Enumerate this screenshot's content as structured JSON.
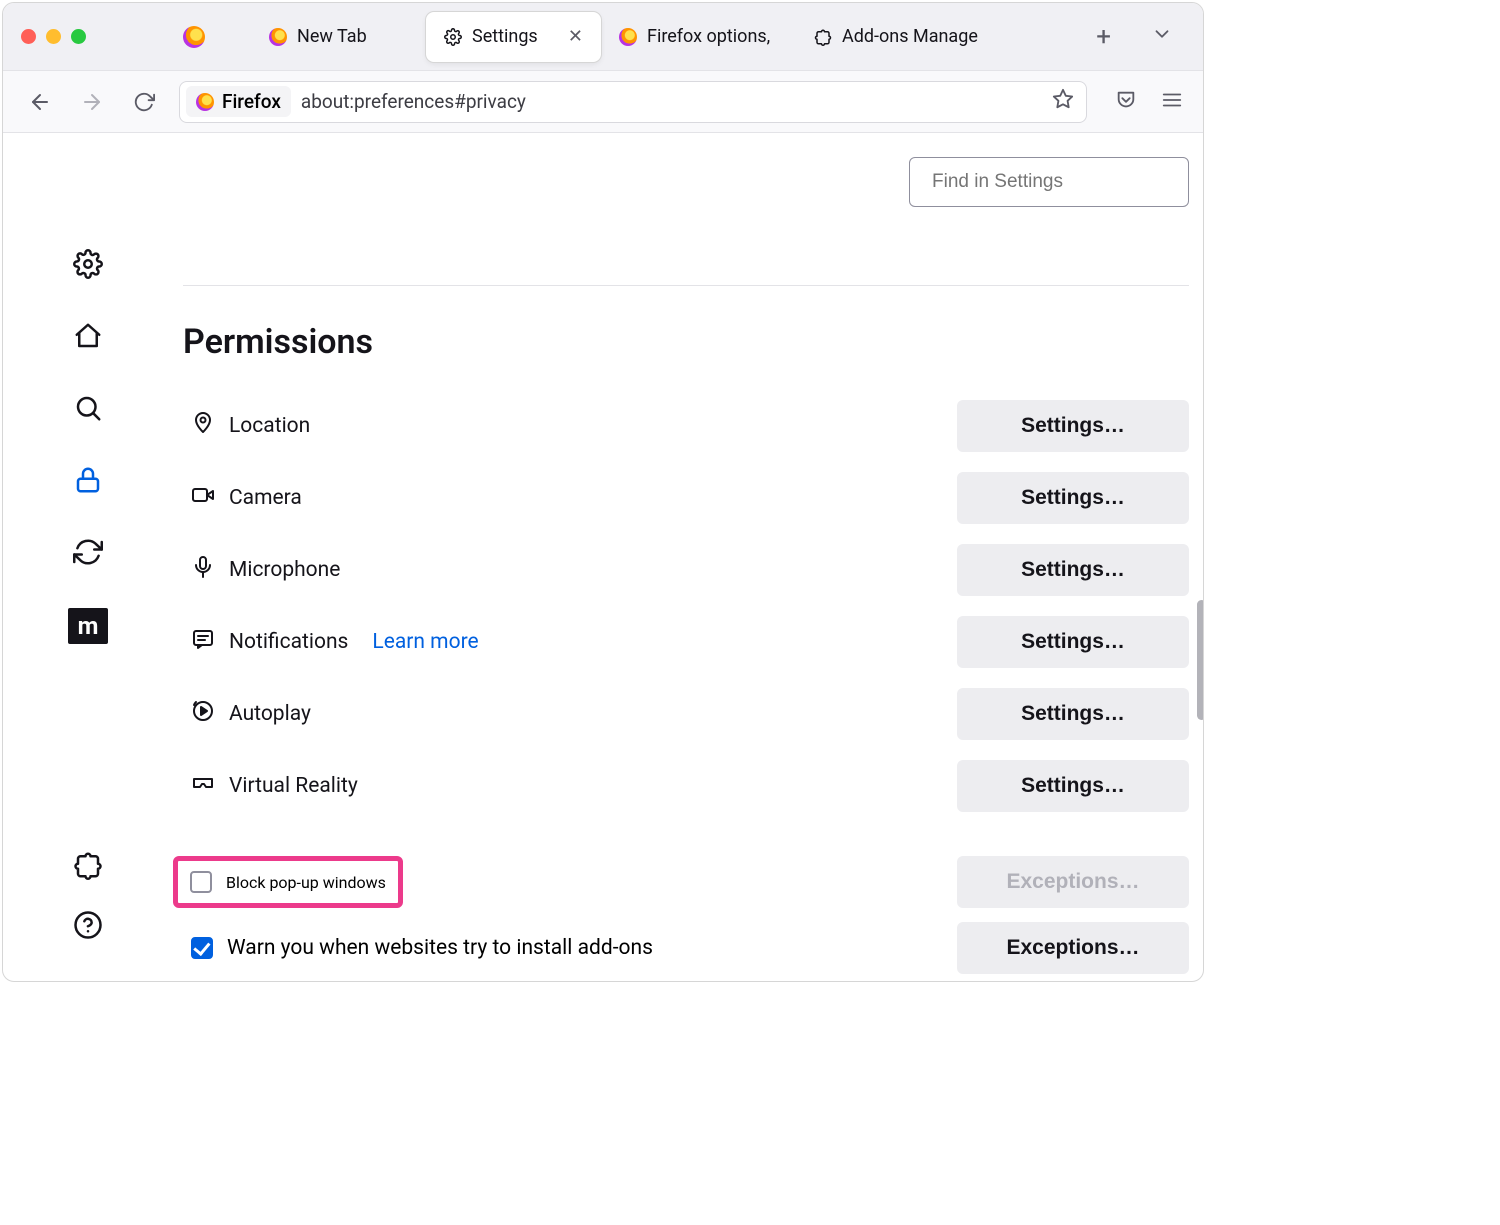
{
  "tabs": [
    {
      "label": "New Tab"
    },
    {
      "label": "Settings"
    },
    {
      "label": "Firefox options,"
    },
    {
      "label": "Add-ons Manage"
    }
  ],
  "addressbar": {
    "identity": "Firefox",
    "url": "about:preferences#privacy"
  },
  "search": {
    "placeholder": "Find in Settings"
  },
  "section_title": "Permissions",
  "permissions": [
    {
      "label": "Location",
      "button": "Settings…"
    },
    {
      "label": "Camera",
      "button": "Settings…"
    },
    {
      "label": "Microphone",
      "button": "Settings…"
    },
    {
      "label": "Notifications",
      "button": "Settings…",
      "learn": "Learn more"
    },
    {
      "label": "Autoplay",
      "button": "Settings…"
    },
    {
      "label": "Virtual Reality",
      "button": "Settings…"
    }
  ],
  "checkboxes": {
    "block_popups": {
      "label": "Block pop-up windows",
      "checked": false,
      "button": "Exceptions…",
      "button_disabled": true
    },
    "warn_addons": {
      "label": "Warn you when websites try to install add-ons",
      "checked": true,
      "button": "Exceptions…",
      "button_disabled": false
    }
  },
  "moz_label": "m"
}
